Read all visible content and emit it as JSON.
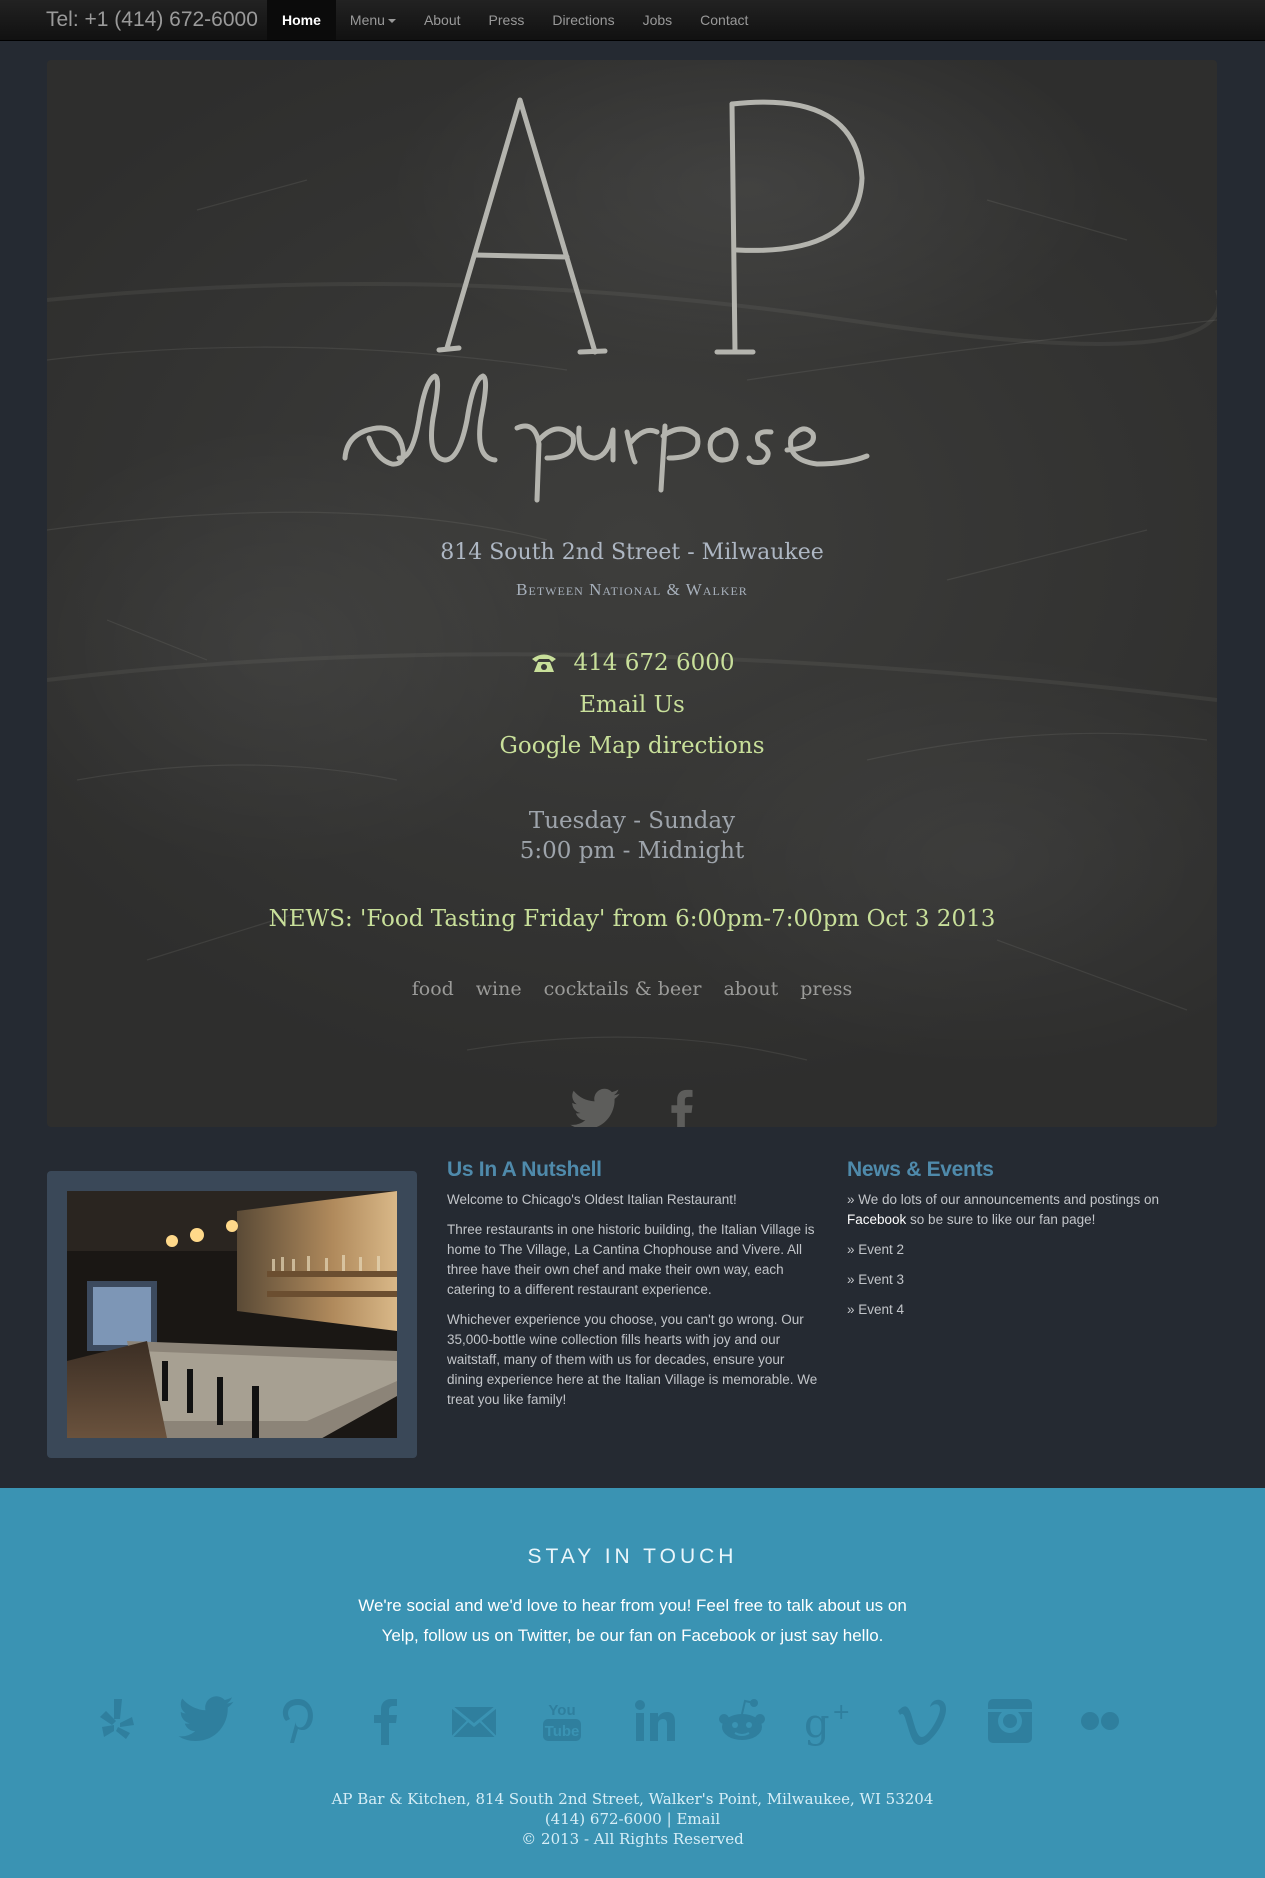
{
  "navbar": {
    "brand": "Tel: +1 (414) 672-6000",
    "items": [
      "Home",
      "Menu",
      "About",
      "Press",
      "Directions",
      "Jobs",
      "Contact"
    ],
    "active": "Home"
  },
  "hero": {
    "logo_letters": "AP",
    "logo_script": "all purpose",
    "address": "814 South 2nd Street - Milwaukee",
    "between": "Between National & Walker",
    "phone": "414 672 6000",
    "email": "Email Us",
    "map": "Google Map directions",
    "hours_days": "Tuesday - Sunday",
    "hours_time": "5:00 pm - Midnight",
    "news": "NEWS: 'Food Tasting Friday' from 6:00pm-7:00pm Oct 3 2013",
    "links": [
      "food",
      "wine",
      "cocktails & beer",
      "about",
      "press"
    ],
    "social": [
      "twitter-icon",
      "facebook-icon"
    ]
  },
  "nutshell": {
    "title": "Us In A Nutshell",
    "p1": "Welcome to Chicago's Oldest Italian Restaurant!",
    "p2": "Three restaurants in one historic building, the Italian Village is home to The Village, La Cantina Chophouse and Vivere. All three have their own chef and make their own way, each catering to a different restaurant experience.",
    "p3": "Whichever experience you choose, you can't go wrong. Our 35,000-bottle wine collection fills hearts with joy and our waitstaff, many of them with us for decades, ensure your dining experience here at the Italian Village is memorable. We treat you like family!"
  },
  "news_events": {
    "title": "News & Events",
    "intro_before": "» We do lots of our announcements and postings on ",
    "intro_link": "Facebook",
    "intro_after": " so be sure to like our fan page!",
    "events": [
      "» Event 2",
      "» Event 3",
      "» Event 4"
    ]
  },
  "footer": {
    "heading": "STAY IN TOUCH",
    "text_line1": "We're social and we'd love to hear from you! Feel free to talk about us on",
    "text_line2": "Yelp, follow us on Twitter, be our fan on Facebook or just say hello.",
    "social_icons": [
      "yelp-icon",
      "twitter-icon",
      "pinterest-icon",
      "facebook-icon",
      "email-icon",
      "youtube-icon",
      "linkedin-icon",
      "reddit-icon",
      "google-plus-icon",
      "vimeo-icon",
      "instagram-icon",
      "flickr-icon"
    ],
    "address": "AP Bar & Kitchen, 814 South 2nd Street, Walker's Point, Milwaukee, WI 53204",
    "phone": "(414) 672-6000",
    "separator": "|",
    "email": "Email",
    "copyright": "© 2013 - All Rights Reserved"
  },
  "colors": {
    "background": "#252a32",
    "accent_green": "#c8df9a",
    "section_title": "#4f8aab",
    "footer_bg": "#3a93b3"
  }
}
